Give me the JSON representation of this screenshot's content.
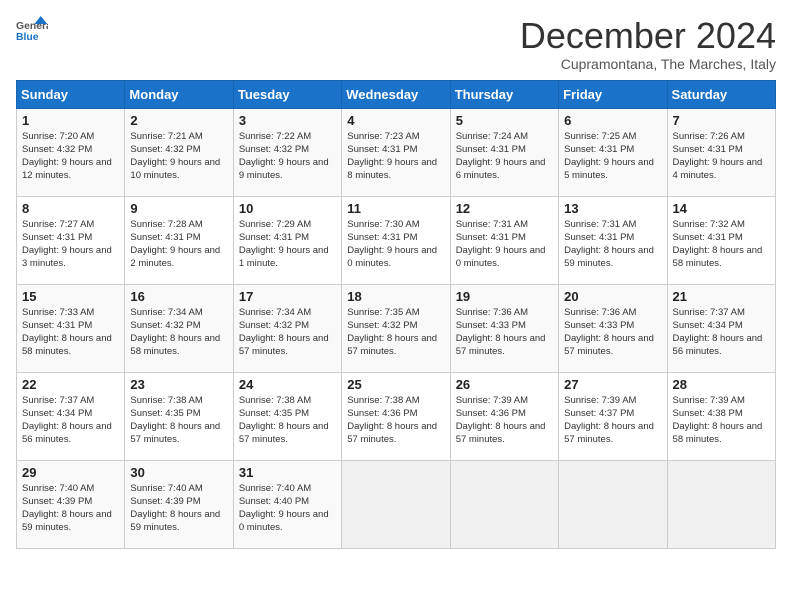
{
  "header": {
    "logo_general": "General",
    "logo_blue": "Blue",
    "month": "December 2024",
    "location": "Cupramontana, The Marches, Italy"
  },
  "weekdays": [
    "Sunday",
    "Monday",
    "Tuesday",
    "Wednesday",
    "Thursday",
    "Friday",
    "Saturday"
  ],
  "weeks": [
    [
      {
        "day": "1",
        "sunrise": "7:20 AM",
        "sunset": "4:32 PM",
        "daylight": "9 hours and 12 minutes."
      },
      {
        "day": "2",
        "sunrise": "7:21 AM",
        "sunset": "4:32 PM",
        "daylight": "9 hours and 10 minutes."
      },
      {
        "day": "3",
        "sunrise": "7:22 AM",
        "sunset": "4:32 PM",
        "daylight": "9 hours and 9 minutes."
      },
      {
        "day": "4",
        "sunrise": "7:23 AM",
        "sunset": "4:31 PM",
        "daylight": "9 hours and 8 minutes."
      },
      {
        "day": "5",
        "sunrise": "7:24 AM",
        "sunset": "4:31 PM",
        "daylight": "9 hours and 6 minutes."
      },
      {
        "day": "6",
        "sunrise": "7:25 AM",
        "sunset": "4:31 PM",
        "daylight": "9 hours and 5 minutes."
      },
      {
        "day": "7",
        "sunrise": "7:26 AM",
        "sunset": "4:31 PM",
        "daylight": "9 hours and 4 minutes."
      }
    ],
    [
      {
        "day": "8",
        "sunrise": "7:27 AM",
        "sunset": "4:31 PM",
        "daylight": "9 hours and 3 minutes."
      },
      {
        "day": "9",
        "sunrise": "7:28 AM",
        "sunset": "4:31 PM",
        "daylight": "9 hours and 2 minutes."
      },
      {
        "day": "10",
        "sunrise": "7:29 AM",
        "sunset": "4:31 PM",
        "daylight": "9 hours and 1 minute."
      },
      {
        "day": "11",
        "sunrise": "7:30 AM",
        "sunset": "4:31 PM",
        "daylight": "9 hours and 0 minutes."
      },
      {
        "day": "12",
        "sunrise": "7:31 AM",
        "sunset": "4:31 PM",
        "daylight": "9 hours and 0 minutes."
      },
      {
        "day": "13",
        "sunrise": "7:31 AM",
        "sunset": "4:31 PM",
        "daylight": "8 hours and 59 minutes."
      },
      {
        "day": "14",
        "sunrise": "7:32 AM",
        "sunset": "4:31 PM",
        "daylight": "8 hours and 58 minutes."
      }
    ],
    [
      {
        "day": "15",
        "sunrise": "7:33 AM",
        "sunset": "4:31 PM",
        "daylight": "8 hours and 58 minutes."
      },
      {
        "day": "16",
        "sunrise": "7:34 AM",
        "sunset": "4:32 PM",
        "daylight": "8 hours and 58 minutes."
      },
      {
        "day": "17",
        "sunrise": "7:34 AM",
        "sunset": "4:32 PM",
        "daylight": "8 hours and 57 minutes."
      },
      {
        "day": "18",
        "sunrise": "7:35 AM",
        "sunset": "4:32 PM",
        "daylight": "8 hours and 57 minutes."
      },
      {
        "day": "19",
        "sunrise": "7:36 AM",
        "sunset": "4:33 PM",
        "daylight": "8 hours and 57 minutes."
      },
      {
        "day": "20",
        "sunrise": "7:36 AM",
        "sunset": "4:33 PM",
        "daylight": "8 hours and 57 minutes."
      },
      {
        "day": "21",
        "sunrise": "7:37 AM",
        "sunset": "4:34 PM",
        "daylight": "8 hours and 56 minutes."
      }
    ],
    [
      {
        "day": "22",
        "sunrise": "7:37 AM",
        "sunset": "4:34 PM",
        "daylight": "8 hours and 56 minutes."
      },
      {
        "day": "23",
        "sunrise": "7:38 AM",
        "sunset": "4:35 PM",
        "daylight": "8 hours and 57 minutes."
      },
      {
        "day": "24",
        "sunrise": "7:38 AM",
        "sunset": "4:35 PM",
        "daylight": "8 hours and 57 minutes."
      },
      {
        "day": "25",
        "sunrise": "7:38 AM",
        "sunset": "4:36 PM",
        "daylight": "8 hours and 57 minutes."
      },
      {
        "day": "26",
        "sunrise": "7:39 AM",
        "sunset": "4:36 PM",
        "daylight": "8 hours and 57 minutes."
      },
      {
        "day": "27",
        "sunrise": "7:39 AM",
        "sunset": "4:37 PM",
        "daylight": "8 hours and 57 minutes."
      },
      {
        "day": "28",
        "sunrise": "7:39 AM",
        "sunset": "4:38 PM",
        "daylight": "8 hours and 58 minutes."
      }
    ],
    [
      {
        "day": "29",
        "sunrise": "7:40 AM",
        "sunset": "4:39 PM",
        "daylight": "8 hours and 59 minutes."
      },
      {
        "day": "30",
        "sunrise": "7:40 AM",
        "sunset": "4:39 PM",
        "daylight": "8 hours and 59 minutes."
      },
      {
        "day": "31",
        "sunrise": "7:40 AM",
        "sunset": "4:40 PM",
        "daylight": "9 hours and 0 minutes."
      },
      null,
      null,
      null,
      null
    ]
  ]
}
